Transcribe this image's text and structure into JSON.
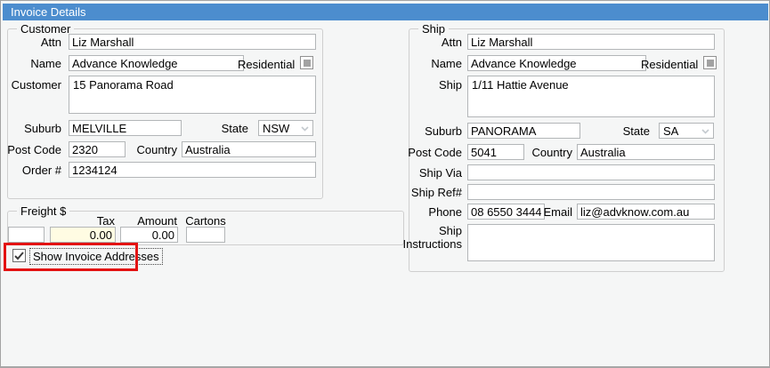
{
  "window": {
    "title": "Invoice Details"
  },
  "colors": {
    "titlebar": "#4c8dce",
    "panel_bg": "#f5f6f6",
    "highlight_red": "#e31212",
    "tax_field_bg": "#fffce3"
  },
  "customer": {
    "group_label": "Customer",
    "attn_label": "Attn",
    "attn_value": "Liz Marshall",
    "name_label": "Name",
    "name_value": "Advance Knowledge",
    "residential_label": "Residential",
    "address_label": "Customer",
    "address_value": "15 Panorama Road",
    "suburb_label": "Suburb",
    "suburb_value": "MELVILLE",
    "state_label": "State",
    "state_value": "NSW",
    "postcode_label": "Post Code",
    "postcode_value": "2320",
    "country_label": "Country",
    "country_value": "Australia",
    "order_label": "Order #",
    "order_value": "1234124"
  },
  "ship": {
    "group_label": "Ship",
    "attn_label": "Attn",
    "attn_value": "Liz Marshall",
    "name_label": "Name",
    "name_value": "Advance Knowledge",
    "residential_label": "Residential",
    "address_label": "Ship",
    "address_value": "1/11 Hattie Avenue",
    "suburb_label": "Suburb",
    "suburb_value": "PANORAMA",
    "state_label": "State",
    "state_value": "SA",
    "postcode_label": "Post Code",
    "postcode_value": "5041",
    "country_label": "Country",
    "country_value": "Australia",
    "ship_via_label": "Ship Via",
    "ship_via_value": "",
    "ship_ref_label": "Ship Ref#",
    "ship_ref_value": "",
    "phone_label": "Phone",
    "phone_value": "08 6550 3444",
    "email_label": "Email",
    "email_value": "liz@advknow.com.au",
    "instructions_label": "Ship Instructions",
    "instructions_value": ""
  },
  "freight": {
    "group_label": "Freight $",
    "tax_header": "Tax",
    "amount_header": "Amount",
    "cartons_header": "Cartons",
    "freight_value": "",
    "tax_value": "0.00",
    "amount_value": "0.00",
    "cartons_value": ""
  },
  "show_invoice_addresses": {
    "label": "Show Invoice Addresses",
    "checked": true
  }
}
